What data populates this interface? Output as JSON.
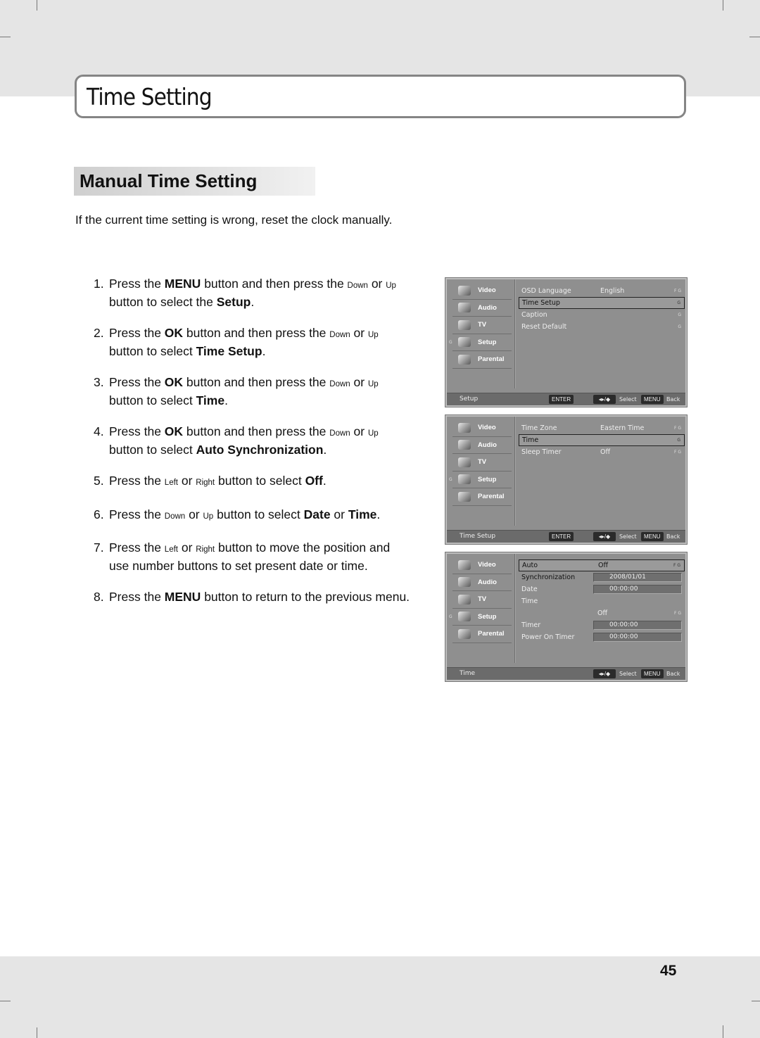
{
  "page": {
    "title": "Time Setting",
    "section_heading": "Manual Time Setting",
    "intro": "If the current time setting is wrong, reset the clock manually.",
    "page_number": "45"
  },
  "steps": [
    {
      "num": "1.",
      "parts": [
        [
          "t",
          "Press the "
        ],
        [
          "b",
          "MENU"
        ],
        [
          "t",
          " button and then press the "
        ],
        [
          "s",
          "Down"
        ],
        [
          "t",
          " or "
        ],
        [
          "s",
          "Up"
        ],
        [
          "t",
          " button to select the "
        ],
        [
          "b",
          "Setup"
        ],
        [
          "t",
          "."
        ]
      ]
    },
    {
      "num": "2.",
      "parts": [
        [
          "t",
          "Press the "
        ],
        [
          "b",
          "OK"
        ],
        [
          "t",
          " button and then press the "
        ],
        [
          "s",
          "Down"
        ],
        [
          "t",
          " or "
        ],
        [
          "s",
          "Up"
        ],
        [
          "t",
          " button to select "
        ],
        [
          "b",
          "Time Setup"
        ],
        [
          "t",
          "."
        ]
      ]
    },
    {
      "num": "3.",
      "parts": [
        [
          "t",
          "Press the "
        ],
        [
          "b",
          "OK"
        ],
        [
          "t",
          " button and then press the "
        ],
        [
          "s",
          "Down"
        ],
        [
          "t",
          " or "
        ],
        [
          "s",
          "Up"
        ],
        [
          "t",
          " button to select "
        ],
        [
          "b",
          "Time"
        ],
        [
          "t",
          "."
        ]
      ]
    },
    {
      "num": "4.",
      "parts": [
        [
          "t",
          "Press the "
        ],
        [
          "b",
          "OK"
        ],
        [
          "t",
          " button and then press the "
        ],
        [
          "s",
          "Down"
        ],
        [
          "t",
          " or "
        ],
        [
          "s",
          "Up"
        ],
        [
          "t",
          " button to select "
        ],
        [
          "b",
          "Auto Synchronization"
        ],
        [
          "t",
          "."
        ]
      ]
    },
    {
      "num": "5.",
      "parts": [
        [
          "t",
          "Press the "
        ],
        [
          "s",
          "Left"
        ],
        [
          "t",
          " or "
        ],
        [
          "s",
          "Right"
        ],
        [
          "t",
          " button to select "
        ],
        [
          "b",
          "Off"
        ],
        [
          "t",
          "."
        ]
      ]
    },
    {
      "num": "6.",
      "parts": [
        [
          "t",
          "Press the "
        ],
        [
          "s",
          "Down"
        ],
        [
          "t",
          " or "
        ],
        [
          "s",
          "Up"
        ],
        [
          "t",
          " button to select "
        ],
        [
          "b",
          "Date"
        ],
        [
          "t",
          " or "
        ],
        [
          "b",
          "Time"
        ],
        [
          "t",
          "."
        ]
      ]
    },
    {
      "num": "7.",
      "parts": [
        [
          "t",
          "Press the "
        ],
        [
          "s",
          "Left"
        ],
        [
          "t",
          " or "
        ],
        [
          "s",
          "Right"
        ],
        [
          "t",
          " button to move the position and use number buttons to set present date or time."
        ]
      ]
    },
    {
      "num": "8.",
      "parts": [
        [
          "t",
          "Press the "
        ],
        [
          "b",
          "MENU"
        ],
        [
          "t",
          " button to return to the previous menu."
        ]
      ]
    }
  ],
  "osd_sidebar": [
    {
      "label": "Video",
      "icon": "video-icon"
    },
    {
      "label": "Audio",
      "icon": "audio-icon"
    },
    {
      "label": "TV",
      "icon": "tv-icon"
    },
    {
      "label": "Setup",
      "icon": "setup-icon",
      "mark": "G"
    },
    {
      "label": "Parental",
      "icon": "parental-icon"
    }
  ],
  "osd_footer": {
    "enter": "ENTER",
    "nav": "◂▸/◆",
    "select": "Select",
    "menu": "MENU",
    "back": "Back"
  },
  "screens": [
    {
      "location": "Setup",
      "show_enter": true,
      "rows": [
        {
          "label": "OSD Language",
          "value": "English",
          "marks": "F G"
        },
        {
          "label": "Time Setup",
          "value": "",
          "marks": "G",
          "selected": true
        },
        {
          "label": "Caption",
          "value": "",
          "marks": "G"
        },
        {
          "label": "Reset Default",
          "value": "",
          "marks": "G"
        }
      ]
    },
    {
      "location": "Time Setup",
      "show_enter": true,
      "rows": [
        {
          "label": "Time Zone",
          "value": "Eastern Time",
          "marks": "F G"
        },
        {
          "label": "Time",
          "value": "",
          "marks": "G",
          "selected": true
        },
        {
          "label": "Sleep Timer",
          "value": "Off",
          "marks": "F G"
        }
      ]
    },
    {
      "location": "Time",
      "show_enter": false,
      "rows": [
        {
          "label": "Auto",
          "value": "Off",
          "marks": "F G",
          "selected": true
        },
        {
          "label": "Synchronization",
          "field": "2008/01/01",
          "dark": true
        },
        {
          "label": "Date",
          "field": "00:00:00"
        },
        {
          "label": "Time",
          "value": ""
        },
        {
          "label": "",
          "value": "Off",
          "marks": "F G"
        },
        {
          "label": "Timer",
          "field": "00:00:00"
        },
        {
          "label": "Power On Timer",
          "field": "00:00:00"
        }
      ]
    }
  ]
}
